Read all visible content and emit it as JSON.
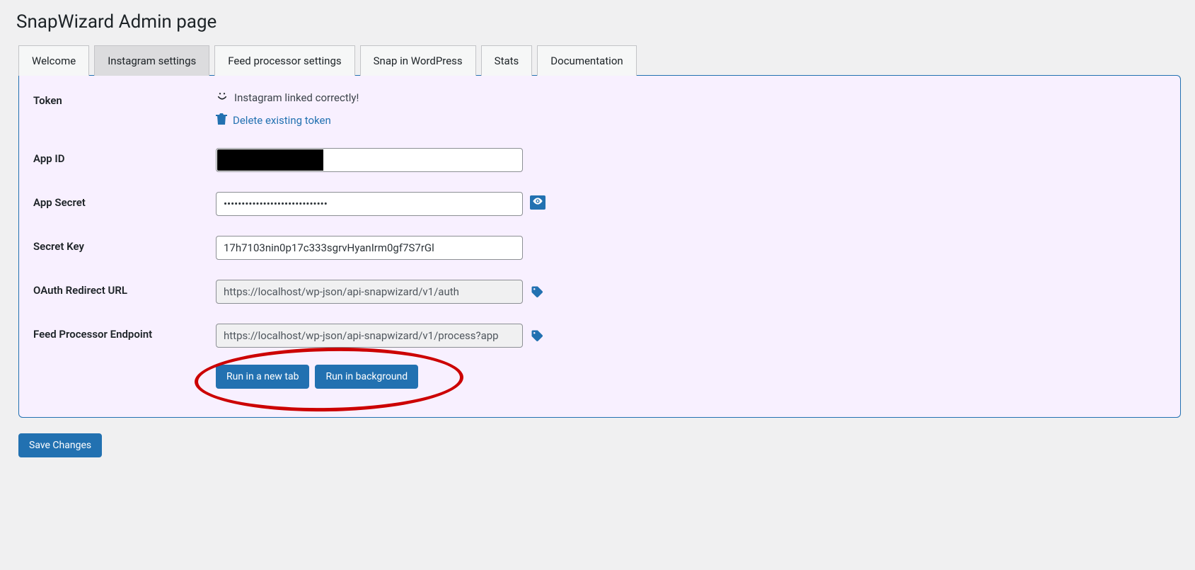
{
  "page_title": "SnapWizard Admin page",
  "tabs": {
    "welcome": "Welcome",
    "instagram": "Instagram settings",
    "feed": "Feed processor settings",
    "snap": "Snap in WordPress",
    "stats": "Stats",
    "docs": "Documentation"
  },
  "form": {
    "token": {
      "label": "Token",
      "status": "Instagram linked correctly!",
      "delete_link": "Delete existing token"
    },
    "app_id": {
      "label": "App ID",
      "value": ""
    },
    "app_secret": {
      "label": "App Secret",
      "value": "•••••••••••••••••••••••••••••"
    },
    "secret_key": {
      "label": "Secret Key",
      "value": "17h7103nin0p17c333sgrvHyanIrm0gf7S7rGl"
    },
    "oauth": {
      "label": "OAuth Redirect URL",
      "value": "https://localhost/wp-json/api-snapwizard/v1/auth"
    },
    "feed_endpoint": {
      "label": "Feed Processor Endpoint",
      "value": "https://localhost/wp-json/api-snapwizard/v1/process?app",
      "run_new_tab": "Run in a new tab",
      "run_bg": "Run in background"
    }
  },
  "save_button": "Save Changes"
}
